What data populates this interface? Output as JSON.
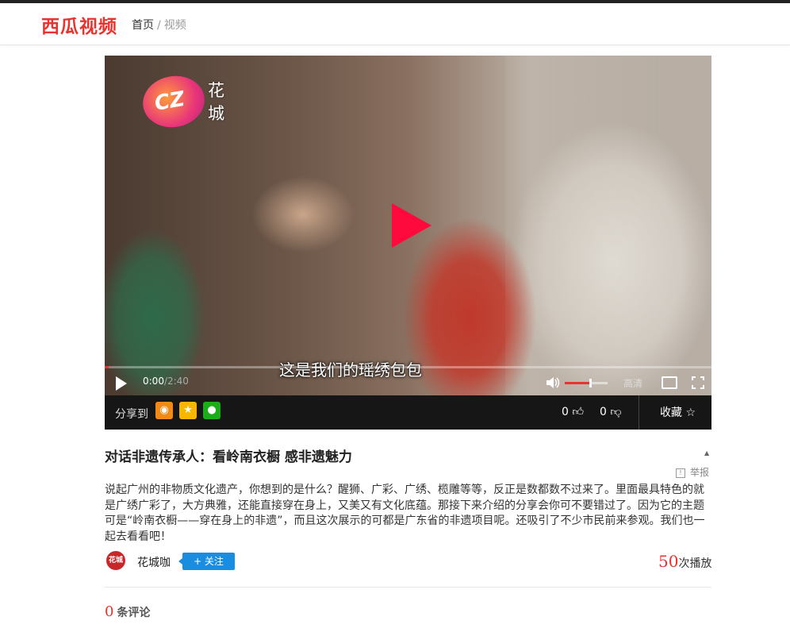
{
  "header": {
    "logo": "西瓜视频",
    "breadcrumb_home": "首页",
    "breadcrumb_sep": "/",
    "breadcrumb_current": "视频"
  },
  "player": {
    "channel_logo": "CZ",
    "channel_name": "花城",
    "subtitle": "这是我们的瑶绣包包",
    "current_time": "0:00",
    "duration": "/2:40",
    "quality": "高清",
    "progress": 0.0,
    "volume": 0.6
  },
  "sharebar": {
    "share_label": "分享到",
    "like_count": "0",
    "dislike_count": "0",
    "collect_label": "收藏"
  },
  "video": {
    "title": "对话非遗传承人：看岭南衣橱 感非遗魅力",
    "report_label": "举报",
    "description": "说起广州的非物质文化遗产，你想到的是什么？醒狮、广彩、广绣、榄雕等等，反正是数都数不过来了。里面最具特色的就是广绣广彩了，大方典雅，还能直接穿在身上，又美又有文化底蕴。那接下来介绍的分享会你可不要错过了。因为它的主题可是“岭南衣橱——穿在身上的非遗”，而且这次展示的可都是广东省的非遗项目呢。还吸引了不少市民前来参观。我们也一起去看看吧！",
    "author": "花城咖",
    "follow_label": "+ 关注",
    "play_count": "50",
    "play_suffix": "次播放"
  },
  "comments": {
    "count": "0",
    "label": "条评论"
  },
  "colors": {
    "brand": "#e8332f",
    "follow": "#1a8de0",
    "play_button": "#ff0a3c"
  }
}
